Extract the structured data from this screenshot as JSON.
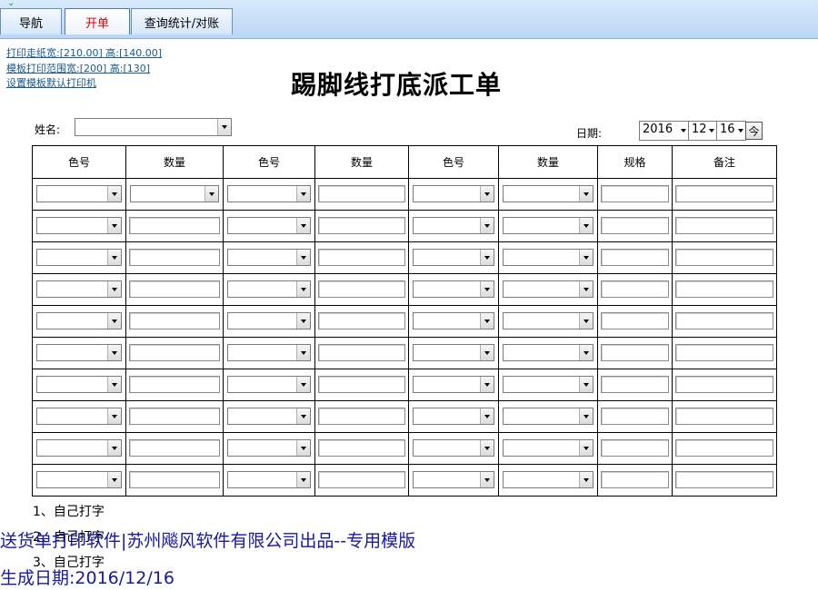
{
  "tabs": [
    {
      "label": "导航"
    },
    {
      "label": "开单"
    },
    {
      "label": "查询统计/对账"
    }
  ],
  "links": {
    "paper_size": "打印走纸宽:[210.00] 高:[140.00]",
    "template_range": "模板打印范围宽:[200] 高:[130]",
    "default_printer": "设置模板默认打印机"
  },
  "title": "踢脚线打底派工单",
  "form": {
    "name_label": "姓名:",
    "name_value": "",
    "date_label": "日期:",
    "year": "2016",
    "month": "12",
    "day": "16",
    "today_button": "今"
  },
  "table": {
    "headers": [
      "色号",
      "数量",
      "色号",
      "数量",
      "色号",
      "数量",
      "规格",
      "备注"
    ],
    "row_count": 10
  },
  "notes": [
    "1、自己打字",
    "2、自己打字",
    "3、自己打字"
  ],
  "footer": {
    "line1": "送货单打印软件|苏州飚风软件有限公司出品--专用模版",
    "line2": "生成日期:2016/12/16"
  }
}
